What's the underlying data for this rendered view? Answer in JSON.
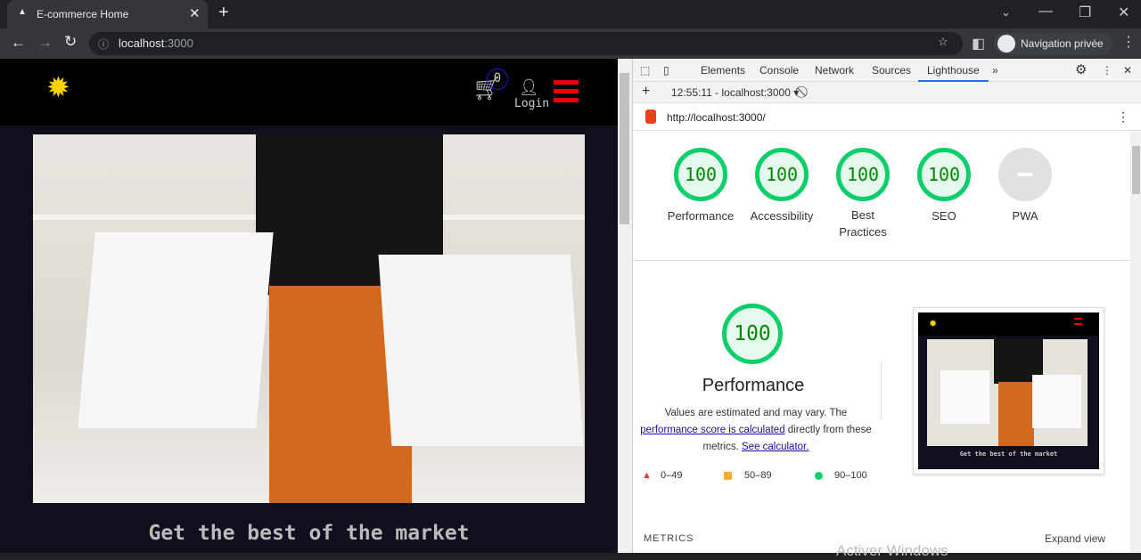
{
  "browser": {
    "tab_title": "E-commerce Home",
    "url_host": "localhost",
    "url_port": ":3000",
    "profile": "Navigation privée"
  },
  "site": {
    "cart_count": "0",
    "login_label": "Login",
    "hero_title": "Get the best of the market"
  },
  "devtools": {
    "tabs": [
      "Elements",
      "Console",
      "Network",
      "Sources",
      "Lighthouse"
    ],
    "active_tab": "Lighthouse",
    "report_select": "12:55:11 - localhost:3000",
    "report_url": "http://localhost:3000/",
    "scores": [
      {
        "label": "Performance",
        "value": "100"
      },
      {
        "label": "Accessibility",
        "value": "100"
      },
      {
        "label": "Best Practices",
        "value": "100"
      },
      {
        "label": "SEO",
        "value": "100"
      },
      {
        "label": "PWA",
        "value": "PWA"
      }
    ],
    "perf": {
      "value": "100",
      "title": "Performance",
      "desc1": "Values are estimated and may vary. The ",
      "link1": "performance score is calculated",
      "desc2": " directly from these metrics. ",
      "link2": "See calculator.",
      "legend": [
        {
          "range": "0–49",
          "color": "#ff3333"
        },
        {
          "range": "50–89",
          "color": "#ffaa33"
        },
        {
          "range": "90–100",
          "color": "#0cce6b"
        }
      ]
    },
    "metrics_label": "METRICS",
    "expand_label": "Expand view",
    "watermark": "Activer Windows"
  }
}
